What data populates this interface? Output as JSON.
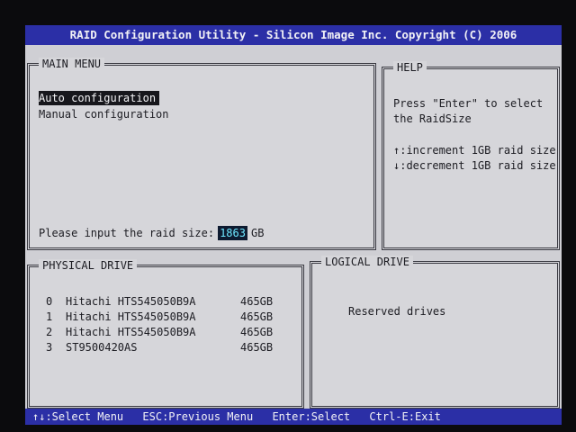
{
  "title": "RAID Configuration Utility - Silicon Image Inc. Copyright (C) 2006",
  "main_menu": {
    "title": "MAIN MENU",
    "items": [
      {
        "label": "Auto configuration",
        "selected": true
      },
      {
        "label": "Manual configuration",
        "selected": false
      }
    ],
    "raid_prompt": "Please input the raid size:",
    "raid_size_value": "1863",
    "raid_size_unit": "GB"
  },
  "help": {
    "title": "HELP",
    "lines": [
      "Press \"Enter\" to select",
      "the RaidSize",
      "↑:increment 1GB raid size",
      "↓:decrement 1GB raid size"
    ]
  },
  "physical_drive": {
    "title": "PHYSICAL DRIVE",
    "drives": [
      {
        "index": "0",
        "model": "Hitachi HTS545050B9A",
        "size": "465GB"
      },
      {
        "index": "1",
        "model": "Hitachi HTS545050B9A",
        "size": "465GB"
      },
      {
        "index": "2",
        "model": "Hitachi HTS545050B9A",
        "size": "465GB"
      },
      {
        "index": "3",
        "model": "ST9500420AS",
        "size": "465GB"
      }
    ]
  },
  "logical_drive": {
    "title": "LOGICAL DRIVE",
    "text": "Reserved drives"
  },
  "statusbar": {
    "items": [
      "↑↓:Select Menu",
      "ESC:Previous Menu",
      "Enter:Select",
      "Ctrl-E:Exit"
    ]
  },
  "colors": {
    "bar_blue": "#2b2fa6",
    "panel_gray": "#d6d6da",
    "selection_black": "#17171c",
    "input_cyan": "#6ee7ff"
  }
}
